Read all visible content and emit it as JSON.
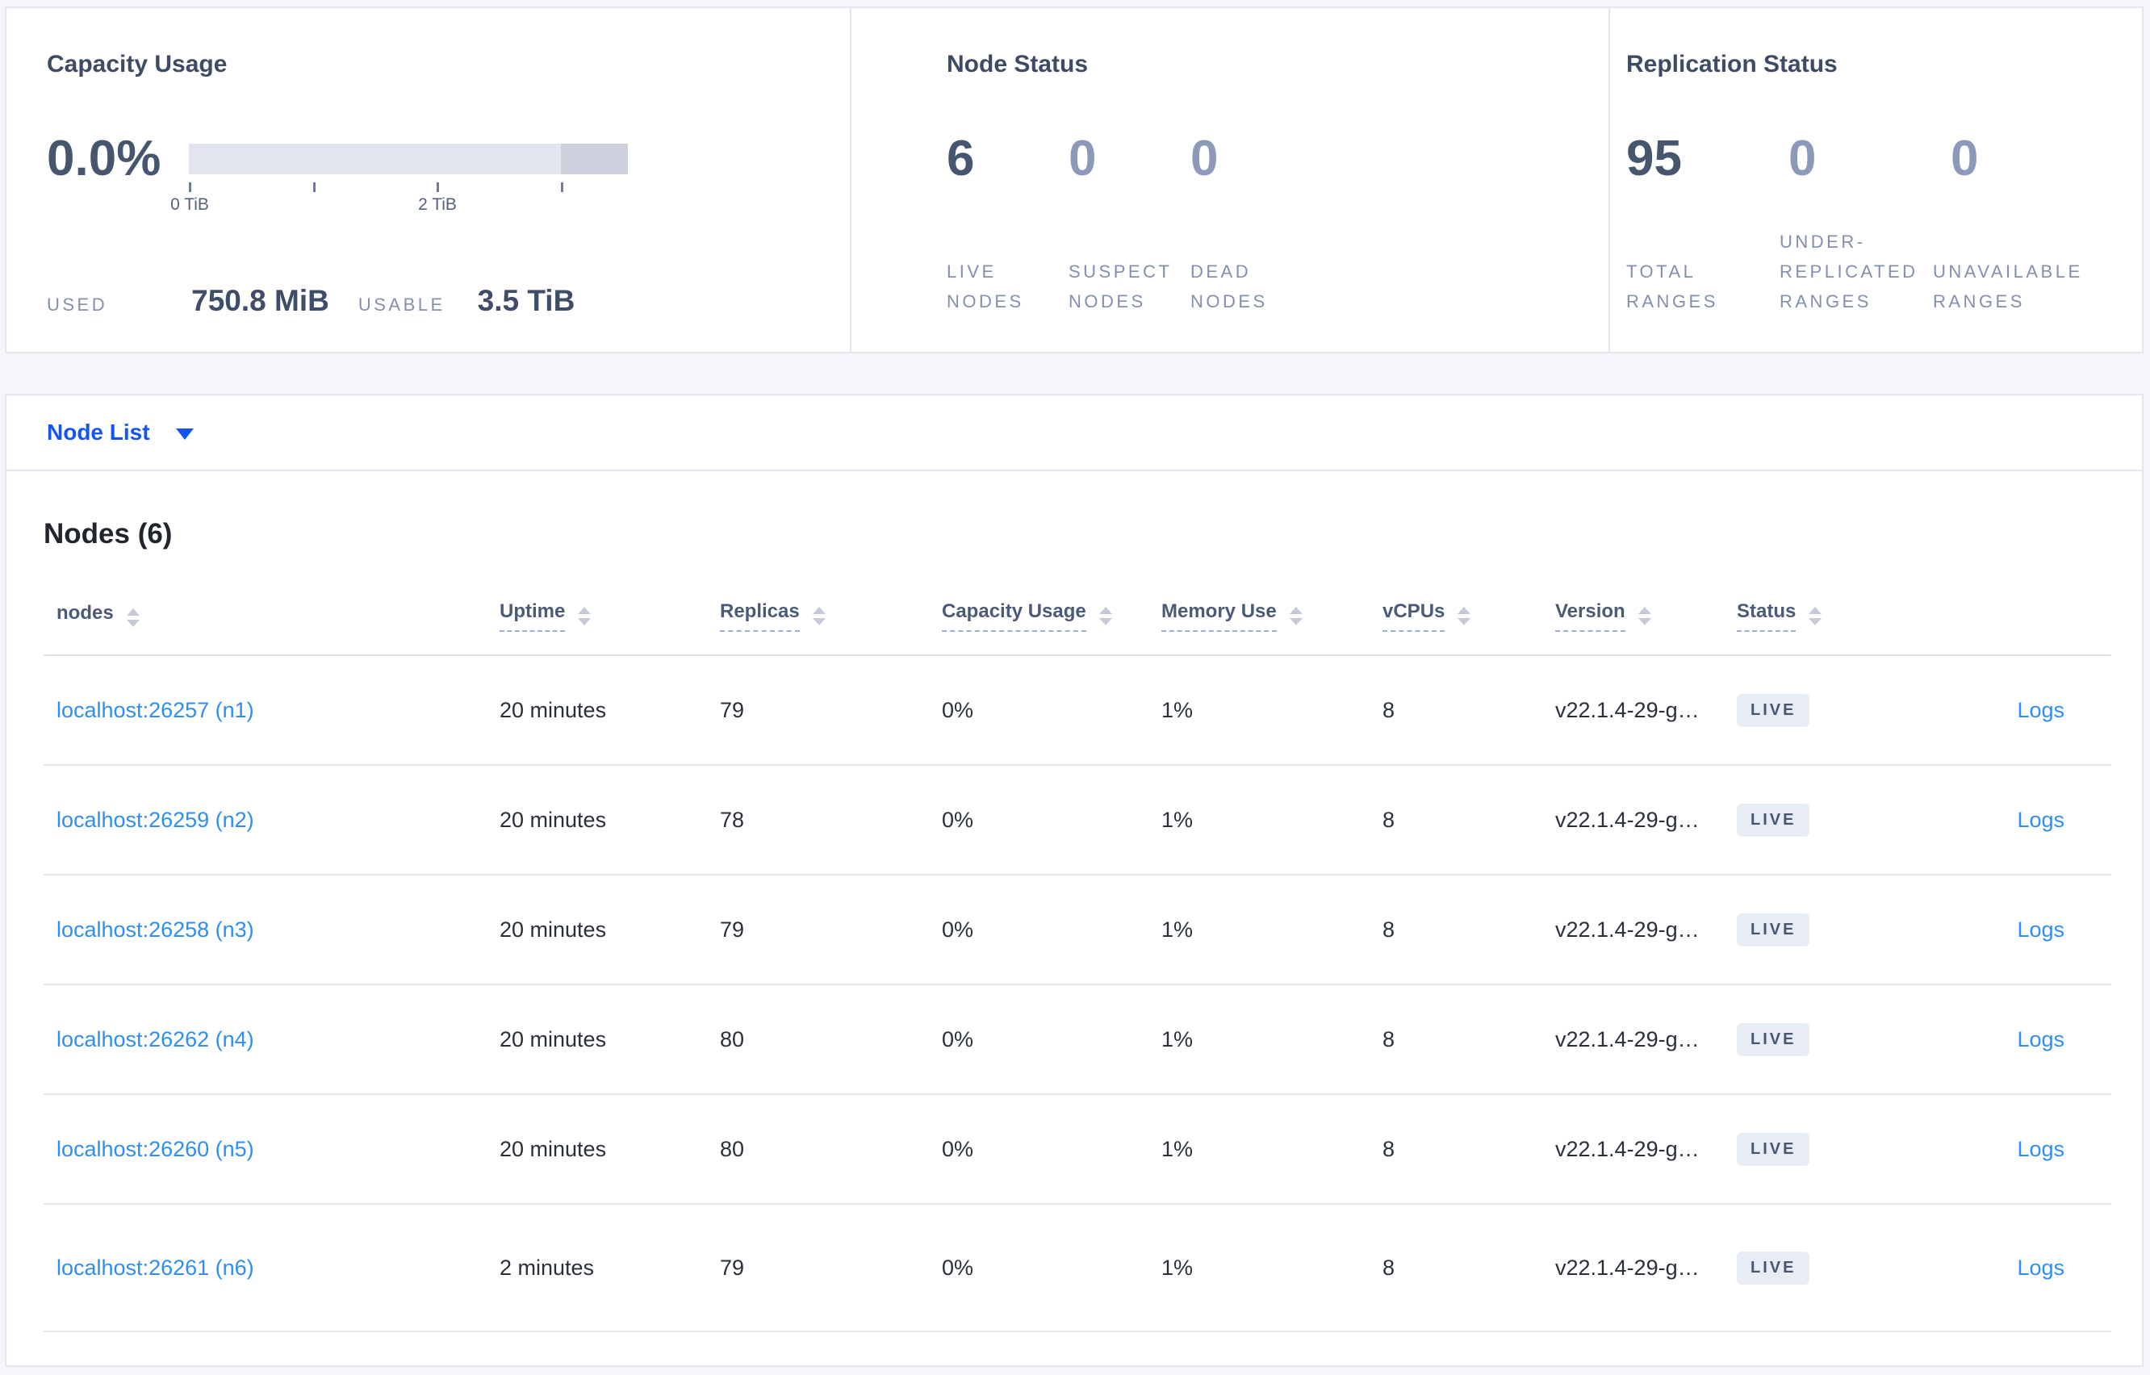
{
  "colors": {
    "page_bg": "#f4f6fa",
    "card_border": "#e3e6ee",
    "accent_blue": "#1453f5",
    "link_blue": "#2e8ef2",
    "title_slate": "#3d4c64",
    "number_dark": "#47566f",
    "number_light": "#8d99b8",
    "caps_label_gray": "#8290ad",
    "bar_light": "#e3e5ee",
    "bar_dark": "#ced1dd",
    "badge_bg": "#e8ecf4",
    "badge_text": "#475672"
  },
  "capacity": {
    "title": "Capacity Usage",
    "percent": "0.0%",
    "tick_labels": [
      "0 TiB",
      "2 TiB"
    ],
    "used_label": "USED",
    "used_value": "750.8 MiB",
    "usable_label": "USABLE",
    "usable_value": "3.5 TiB"
  },
  "node_status": {
    "title": "Node Status",
    "stats": [
      {
        "value": "6",
        "label": "LIVE NODES"
      },
      {
        "value": "0",
        "label": "SUSPECT NODES"
      },
      {
        "value": "0",
        "label": "DEAD NODES"
      }
    ]
  },
  "replication": {
    "title": "Replication Status",
    "stats": [
      {
        "value": "95",
        "label": "TOTAL RANGES"
      },
      {
        "value": "0",
        "label": "UNDER-REPLICATED RANGES"
      },
      {
        "value": "0",
        "label": "UNAVAILABLE RANGES"
      }
    ]
  },
  "node_list": {
    "selector_label": "Node List",
    "heading": "Nodes (6)",
    "columns": {
      "nodes": "nodes",
      "uptime": "Uptime",
      "replicas": "Replicas",
      "capacity": "Capacity Usage",
      "memory": "Memory Use",
      "vcpus": "vCPUs",
      "version": "Version",
      "status": "Status"
    },
    "logs_label": "Logs",
    "rows": [
      {
        "node": "localhost:26257 (n1)",
        "uptime": "20 minutes",
        "replicas": "79",
        "capacity": "0%",
        "memory": "1%",
        "vcpus": "8",
        "version": "v22.1.4-29-g…",
        "status": "LIVE"
      },
      {
        "node": "localhost:26259 (n2)",
        "uptime": "20 minutes",
        "replicas": "78",
        "capacity": "0%",
        "memory": "1%",
        "vcpus": "8",
        "version": "v22.1.4-29-g…",
        "status": "LIVE"
      },
      {
        "node": "localhost:26258 (n3)",
        "uptime": "20 minutes",
        "replicas": "79",
        "capacity": "0%",
        "memory": "1%",
        "vcpus": "8",
        "version": "v22.1.4-29-g…",
        "status": "LIVE"
      },
      {
        "node": "localhost:26262 (n4)",
        "uptime": "20 minutes",
        "replicas": "80",
        "capacity": "0%",
        "memory": "1%",
        "vcpus": "8",
        "version": "v22.1.4-29-g…",
        "status": "LIVE"
      },
      {
        "node": "localhost:26260 (n5)",
        "uptime": "20 minutes",
        "replicas": "80",
        "capacity": "0%",
        "memory": "1%",
        "vcpus": "8",
        "version": "v22.1.4-29-g…",
        "status": "LIVE"
      },
      {
        "node": "localhost:26261 (n6)",
        "uptime": "2 minutes",
        "replicas": "79",
        "capacity": "0%",
        "memory": "1%",
        "vcpus": "8",
        "version": "v22.1.4-29-g…",
        "status": "LIVE"
      }
    ]
  }
}
